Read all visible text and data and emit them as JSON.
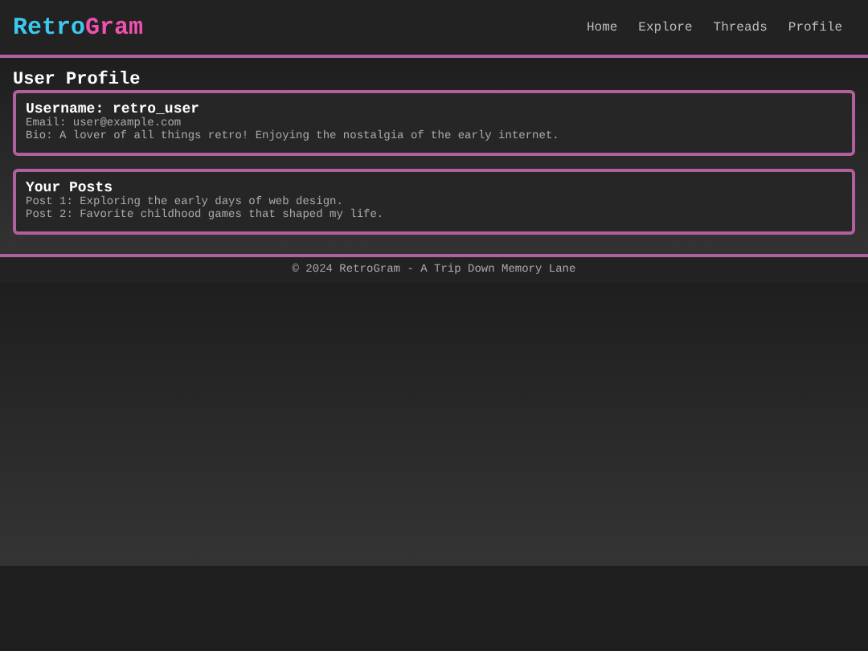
{
  "logo": {
    "parts": [
      {
        "text": "Retro",
        "color": "#3cc8f0"
      },
      {
        "text": "Gram",
        "color": "#f050b0"
      }
    ]
  },
  "nav": [
    {
      "label": "Home"
    },
    {
      "label": "Explore"
    },
    {
      "label": "Threads"
    },
    {
      "label": "Profile"
    }
  ],
  "page_title": "User Profile",
  "cards": [
    {
      "title": "Username: retro_user",
      "lines": [
        "Email: user@example.com",
        "Bio: A lover of all things retro! Enjoying the nostalgia of the early internet."
      ]
    },
    {
      "title": "Your Posts",
      "lines": [
        "Post 1: Exploring the early days of web design.",
        "Post 2: Favorite childhood games that shaped my life."
      ]
    }
  ],
  "footer": "© 2024 RetroGram - A Trip Down Memory Lane"
}
